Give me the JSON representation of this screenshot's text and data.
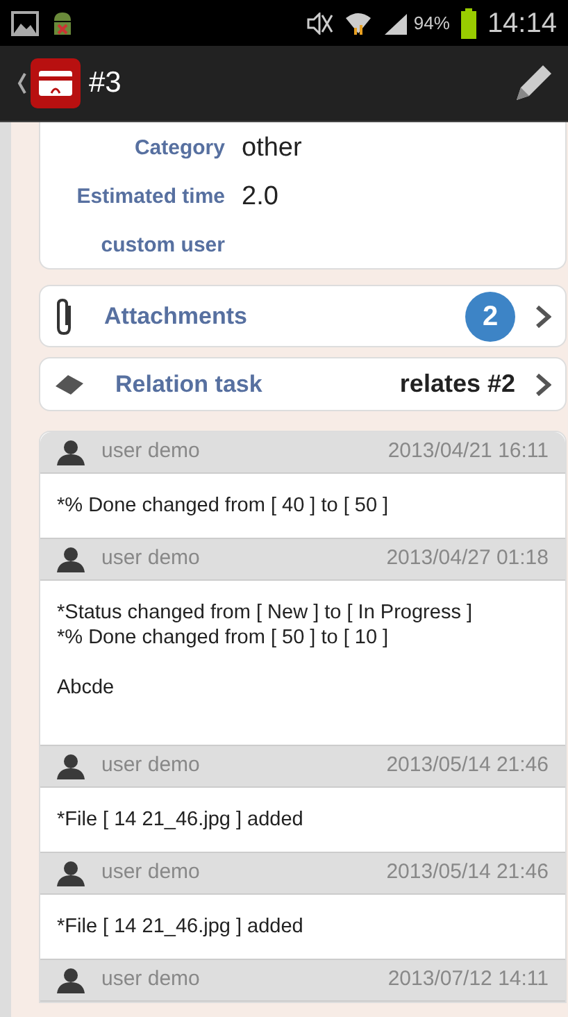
{
  "status_bar": {
    "battery": "94%",
    "time": "14:14"
  },
  "action_bar": {
    "title": "#3"
  },
  "details": [
    {
      "label": "Category",
      "value": "other"
    },
    {
      "label": "Estimated time",
      "value": "2.0"
    },
    {
      "label": "custom user"
    }
  ],
  "attachments": {
    "label": "Attachments",
    "count": "2"
  },
  "relation": {
    "label": "Relation task",
    "value": "relates #2"
  },
  "journals": [
    {
      "user": "user demo",
      "date": "2013/04/21 16:11",
      "text": "*% Done changed from [ 40 ] to [ 50 ]"
    },
    {
      "user": "user demo",
      "date": "2013/04/27 01:18",
      "text": "*Status changed from [ New ] to [ In Progress ]\n*% Done changed from [ 50 ] to [ 10 ]\n\nAbcde\n "
    },
    {
      "user": "user demo",
      "date": "2013/05/14 21:46",
      "text": "*File [ 14 21_46.jpg ] added"
    },
    {
      "user": "user demo",
      "date": "2013/05/14 21:46",
      "text": "*File [ 14 21_46.jpg ] added"
    },
    {
      "user": "user demo",
      "date": "2013/07/12 14:11"
    }
  ]
}
